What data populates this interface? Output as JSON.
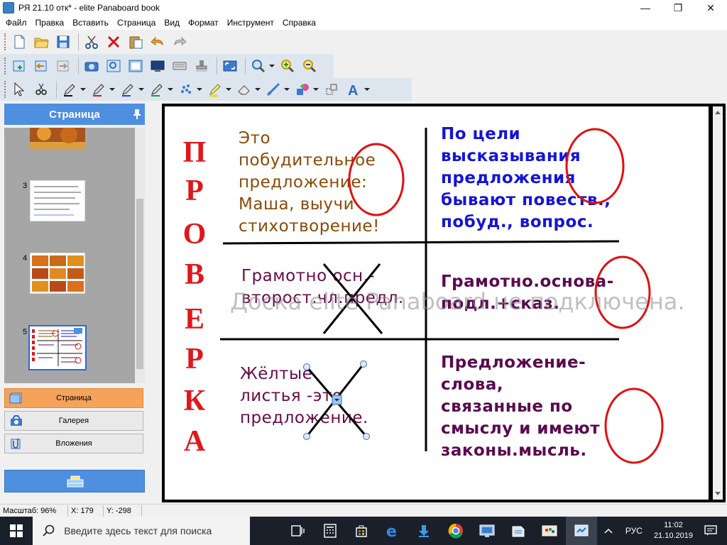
{
  "window": {
    "title": "РЯ 21.10 отк* - elite Panaboard book",
    "minimize": "—",
    "maximize": "❐",
    "close": "✕"
  },
  "menu": [
    "Файл",
    "Правка",
    "Вставить",
    "Страница",
    "Вид",
    "Формат",
    "Инструмент",
    "Справка"
  ],
  "sidebar": {
    "header": "Страница",
    "thumb_numbers": [
      "3",
      "4",
      "5"
    ],
    "buttons": [
      "Страница",
      "Галерея",
      "Вложения"
    ]
  },
  "slide": {
    "vertical_word": [
      "П",
      "Р",
      "О",
      "В",
      "Е",
      "Р",
      "К",
      "А"
    ],
    "cells": {
      "r1c1": [
        "Это",
        "побудительное",
        "предложение:",
        "Маша, выучи",
        "стихотворение!"
      ],
      "r1c2": [
        "По цели",
        "высказывания",
        "предложения",
        "бывают повеств.,",
        "побуд., вопрос."
      ],
      "r2c1": [
        "Грамотно осн.-",
        "второст.чл.предл."
      ],
      "r2c2": [
        "Грамотно.основа-",
        "подл.+сказ."
      ],
      "r3c1": [
        "Жёлтые",
        "листья -это",
        "предложение."
      ],
      "r3c2": [
        "Предложение-",
        "слова,",
        "связанные по",
        "смыслу и имеют",
        "законы.мысль."
      ]
    },
    "watermark": "Доска elite Panaboard не подключена."
  },
  "status": {
    "zoom": "Масштаб: 96%",
    "x": "X: 179",
    "y": "Y: -298"
  },
  "taskbar": {
    "search_placeholder": "Введите здесь текст для поиска",
    "language": "РУС",
    "time": "11:02",
    "date": "21.10.2019"
  },
  "colors": {
    "header_blue": "#4e8fe0",
    "active_orange": "#f5a25b",
    "letter_red": "#e0171c",
    "circle_red": "#e01010"
  }
}
